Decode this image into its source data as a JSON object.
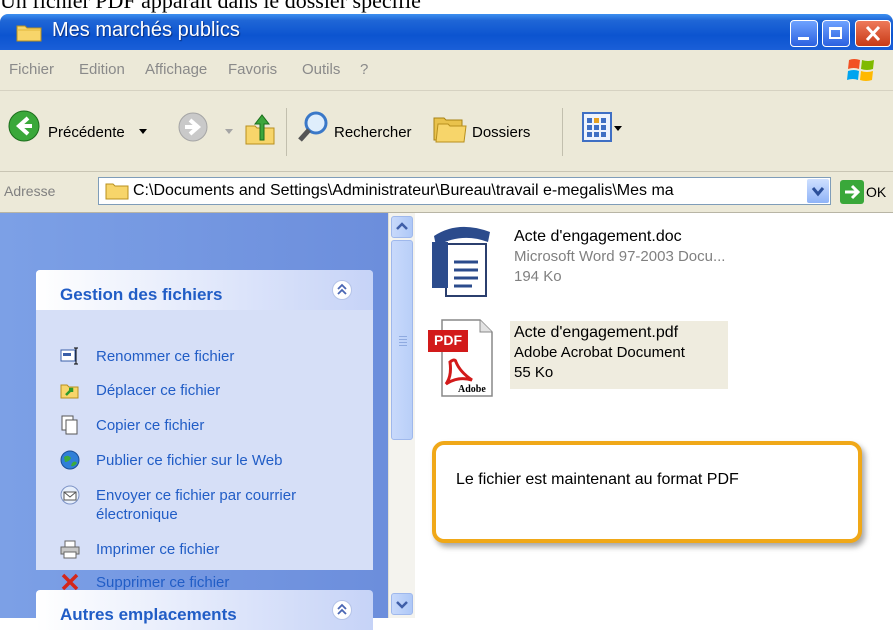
{
  "window": {
    "title": "Mes marchés publics"
  },
  "menu": [
    "Fichier",
    "Edition",
    "Affichage",
    "Favoris",
    "Outils",
    "?"
  ],
  "toolbar": {
    "back_label": "Précédente",
    "search_label": "Rechercher",
    "folders_label": "Dossiers"
  },
  "address": {
    "label": "Adresse",
    "path": "C:\\Documents and Settings\\Administrateur\\Bureau\\travail e-megalis\\Mes ma",
    "go_label": "OK"
  },
  "tasks_panel": {
    "title": "Gestion des fichiers",
    "items": [
      {
        "label": "Renommer ce fichier",
        "icon": "rename-icon"
      },
      {
        "label": "Déplacer ce fichier",
        "icon": "move-icon"
      },
      {
        "label": "Copier ce fichier",
        "icon": "copy-icon"
      },
      {
        "label": "Publier ce fichier sur le Web",
        "icon": "web-publish-icon"
      },
      {
        "label": "Envoyer ce fichier par courrier électronique",
        "icon": "email-icon"
      },
      {
        "label": "Imprimer ce fichier",
        "icon": "printer-icon"
      },
      {
        "label": "Supprimer ce fichier",
        "icon": "delete-icon"
      }
    ]
  },
  "other_places": {
    "title": "Autres emplacements"
  },
  "files": [
    {
      "name": "Acte d'engagement.doc",
      "type": "Microsoft Word 97-2003 Docu...",
      "size": "194 Ko",
      "icon": "word-document-icon"
    },
    {
      "name": "Acte d'engagement.pdf",
      "type": "Adobe Acrobat Document",
      "size": "55 Ko",
      "icon": "pdf-document-icon",
      "pdf_badge": "PDF",
      "adobe_badge": "Adobe"
    }
  ],
  "callout": {
    "text": "Le fichier est maintenant au format PDF"
  },
  "colors": {
    "title_bar": "#0c54d0",
    "task_text": "#215dc6",
    "callout_border": "#f0a818"
  }
}
